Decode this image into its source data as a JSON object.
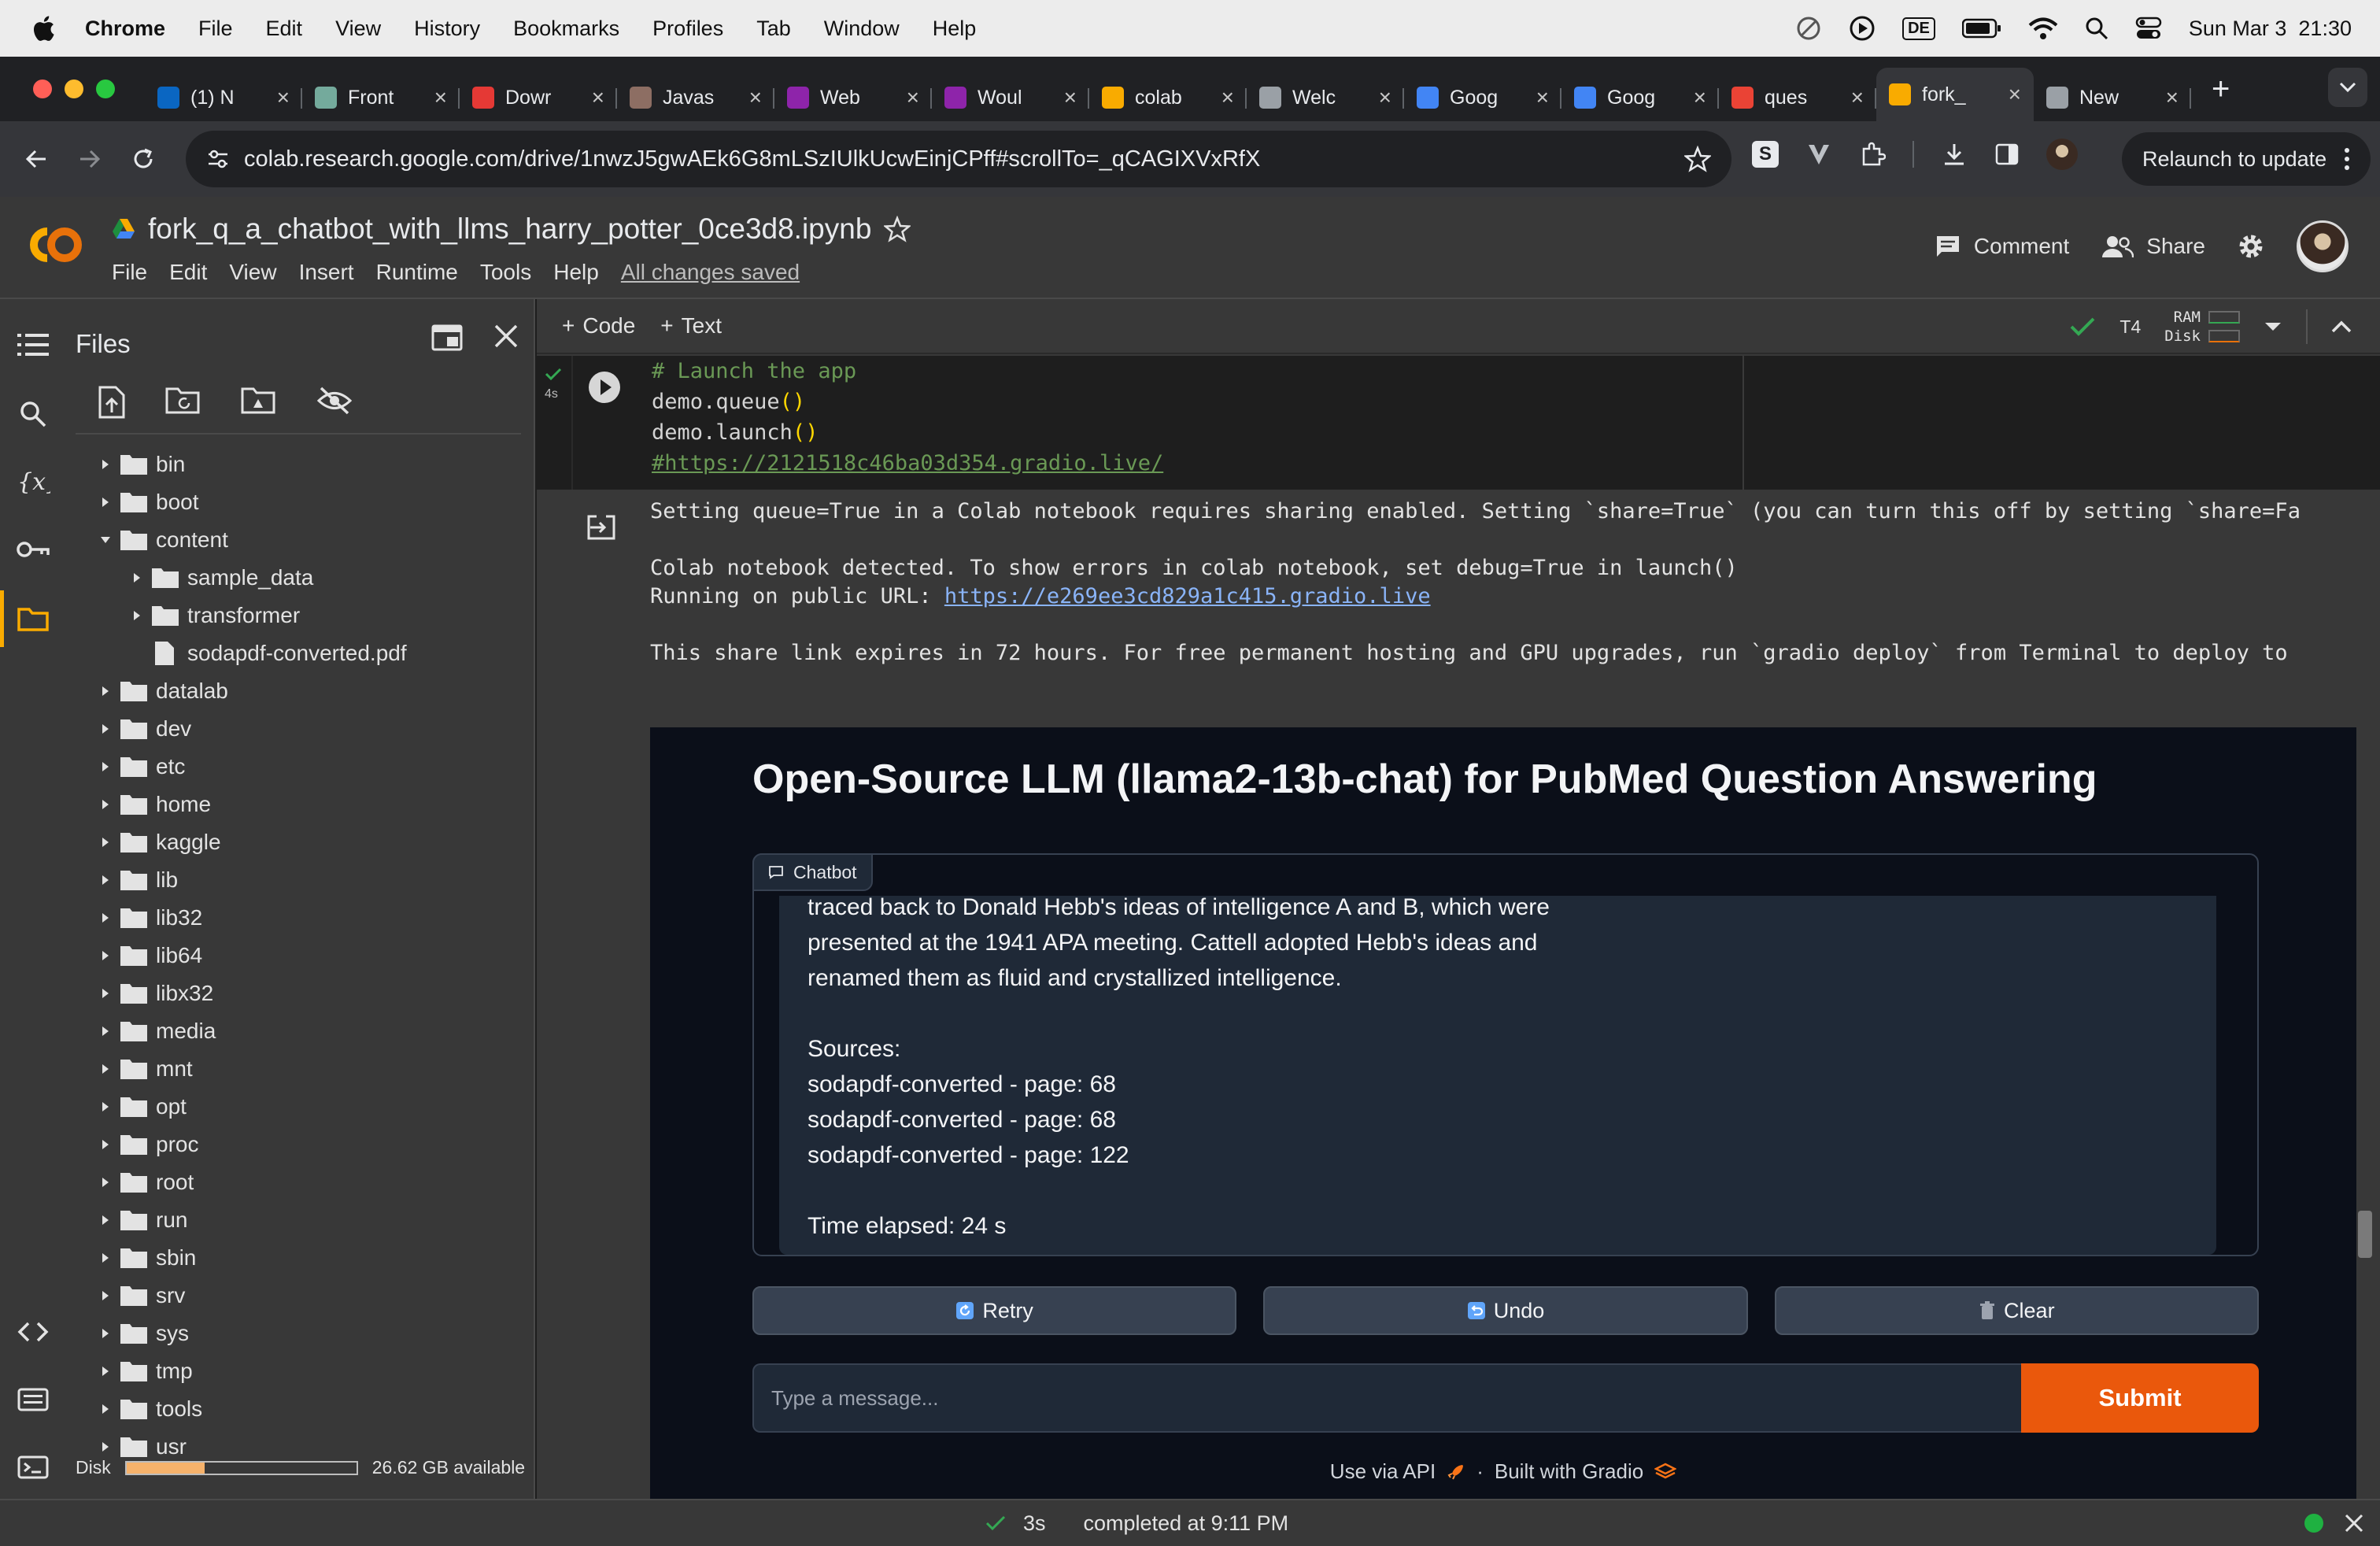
{
  "menubar": {
    "app": "Chrome",
    "items": [
      "File",
      "Edit",
      "View",
      "History",
      "Bookmarks",
      "Profiles",
      "Tab",
      "Window",
      "Help"
    ],
    "input_source": "DE",
    "clock": "Sun Mar 3  21:30"
  },
  "tabs": [
    {
      "title": "(1) N",
      "icon": "linkedin-icon",
      "color": "#0a66c2"
    },
    {
      "title": "Front",
      "icon": "chatgpt-icon",
      "color": "#74aa9c"
    },
    {
      "title": "Dowr",
      "icon": "heart-icon",
      "color": "#e53935"
    },
    {
      "title": "Javas",
      "icon": "bug-icon",
      "color": "#8d6e63"
    },
    {
      "title": "Web",
      "icon": "figma-like-icon",
      "color": "#8e24aa"
    },
    {
      "title": "Woul",
      "icon": "figma-like-icon",
      "color": "#8e24aa"
    },
    {
      "title": "colab",
      "icon": "colab-icon",
      "color": "#f9ab00"
    },
    {
      "title": "Welc",
      "icon": "globe-icon",
      "color": "#9aa0a6"
    },
    {
      "title": "Goog",
      "icon": "google-icon",
      "color": "#4285f4"
    },
    {
      "title": "Goog",
      "icon": "google-icon",
      "color": "#4285f4"
    },
    {
      "title": "ques",
      "icon": "gmail-icon",
      "color": "#ea4335"
    },
    {
      "title": "fork_",
      "icon": "colab-icon",
      "color": "#f9ab00",
      "active": true
    },
    {
      "title": "New",
      "icon": "chrome-icon",
      "color": "#9aa0a6"
    }
  ],
  "address": {
    "url": "colab.research.google.com/drive/1nwzJ5gwAEk6G8mLSzIUlkUcwEinjCPff#scrollTo=_qCAGIXVxRfX",
    "relaunch_label": "Relaunch to update"
  },
  "notebook": {
    "title": "fork_q_a_chatbot_with_llms_harry_potter_0ce3d8.ipynb",
    "menu": [
      "File",
      "Edit",
      "View",
      "Insert",
      "Runtime",
      "Tools",
      "Help"
    ],
    "save_status": "All changes saved",
    "comment_label": "Comment",
    "share_label": "Share"
  },
  "toolbar": {
    "code_label": "Code",
    "text_label": "Text",
    "runtime": "T4",
    "ram_label": "RAM",
    "disk_label": "Disk"
  },
  "files": {
    "title": "Files",
    "tree": [
      {
        "name": "bin",
        "type": "folder",
        "depth": 0,
        "expanded": false
      },
      {
        "name": "boot",
        "type": "folder",
        "depth": 0,
        "expanded": false
      },
      {
        "name": "content",
        "type": "folder",
        "depth": 0,
        "expanded": true
      },
      {
        "name": "sample_data",
        "type": "folder",
        "depth": 1,
        "expanded": false
      },
      {
        "name": "transformer",
        "type": "folder",
        "depth": 1,
        "expanded": false
      },
      {
        "name": "sodapdf-converted.pdf",
        "type": "file",
        "depth": 1
      },
      {
        "name": "datalab",
        "type": "folder",
        "depth": 0,
        "expanded": false
      },
      {
        "name": "dev",
        "type": "folder",
        "depth": 0,
        "expanded": false
      },
      {
        "name": "etc",
        "type": "folder",
        "depth": 0,
        "expanded": false
      },
      {
        "name": "home",
        "type": "folder",
        "depth": 0,
        "expanded": false
      },
      {
        "name": "kaggle",
        "type": "folder",
        "depth": 0,
        "expanded": false
      },
      {
        "name": "lib",
        "type": "folder",
        "depth": 0,
        "expanded": false
      },
      {
        "name": "lib32",
        "type": "folder",
        "depth": 0,
        "expanded": false
      },
      {
        "name": "lib64",
        "type": "folder",
        "depth": 0,
        "expanded": false
      },
      {
        "name": "libx32",
        "type": "folder",
        "depth": 0,
        "expanded": false
      },
      {
        "name": "media",
        "type": "folder",
        "depth": 0,
        "expanded": false
      },
      {
        "name": "mnt",
        "type": "folder",
        "depth": 0,
        "expanded": false
      },
      {
        "name": "opt",
        "type": "folder",
        "depth": 0,
        "expanded": false
      },
      {
        "name": "proc",
        "type": "folder",
        "depth": 0,
        "expanded": false
      },
      {
        "name": "root",
        "type": "folder",
        "depth": 0,
        "expanded": false
      },
      {
        "name": "run",
        "type": "folder",
        "depth": 0,
        "expanded": false
      },
      {
        "name": "sbin",
        "type": "folder",
        "depth": 0,
        "expanded": false
      },
      {
        "name": "srv",
        "type": "folder",
        "depth": 0,
        "expanded": false
      },
      {
        "name": "sys",
        "type": "folder",
        "depth": 0,
        "expanded": false
      },
      {
        "name": "tmp",
        "type": "folder",
        "depth": 0,
        "expanded": false
      },
      {
        "name": "tools",
        "type": "folder",
        "depth": 0,
        "expanded": false
      },
      {
        "name": "usr",
        "type": "folder",
        "depth": 0,
        "expanded": false
      }
    ],
    "disk_label": "Disk",
    "disk_used_fraction": 0.34,
    "disk_available": "26.62 GB available"
  },
  "cell": {
    "exec_time": "4s",
    "code_lines": [
      {
        "text": "# Launch the app",
        "kind": "comment"
      },
      {
        "text": "demo.queue()",
        "kind": "code"
      },
      {
        "text": "demo.launch()",
        "kind": "code"
      },
      {
        "text": "#https://2121518c46ba03d354.gradio.live/",
        "kind": "comment-link"
      }
    ],
    "output_line1": "Setting queue=True in a Colab notebook requires sharing enabled. Setting `share=True` (you can turn this off by setting `share=Fa",
    "output_line2": "Colab notebook detected. To show errors in colab notebook, set debug=True in launch()",
    "output_line3_prefix": "Running on public URL: ",
    "output_line3_link": "https://e269ee3cd829a1c415.gradio.live",
    "output_line4": "This share link expires in 72 hours. For free permanent hosting and GPU upgrades, run `gradio deploy` from Terminal to deploy to"
  },
  "gradio": {
    "title": "Open-Source LLM (llama2-13b-chat) for PubMed Question Answering",
    "chatbot_label": "Chatbot",
    "message": "traced back to Donald Hebb's ideas of intelligence A and B, which were\npresented at the 1941 APA meeting. Cattell adopted Hebb's ideas and\nrenamed them as fluid and crystallized intelligence.\n\nSources:\nsodapdf-converted - page: 68\nsodapdf-converted - page: 68\nsodapdf-converted - page: 122\n\nTime elapsed: 24 s",
    "retry_label": "Retry",
    "undo_label": "Undo",
    "clear_label": "Clear",
    "input_placeholder": "Type a message...",
    "submit_label": "Submit",
    "footer_api": "Use via API",
    "footer_sep": "·",
    "footer_built": "Built with Gradio",
    "accent": "#ea580c"
  },
  "status": {
    "duration": "3s",
    "message": "completed at 9:11 PM"
  }
}
